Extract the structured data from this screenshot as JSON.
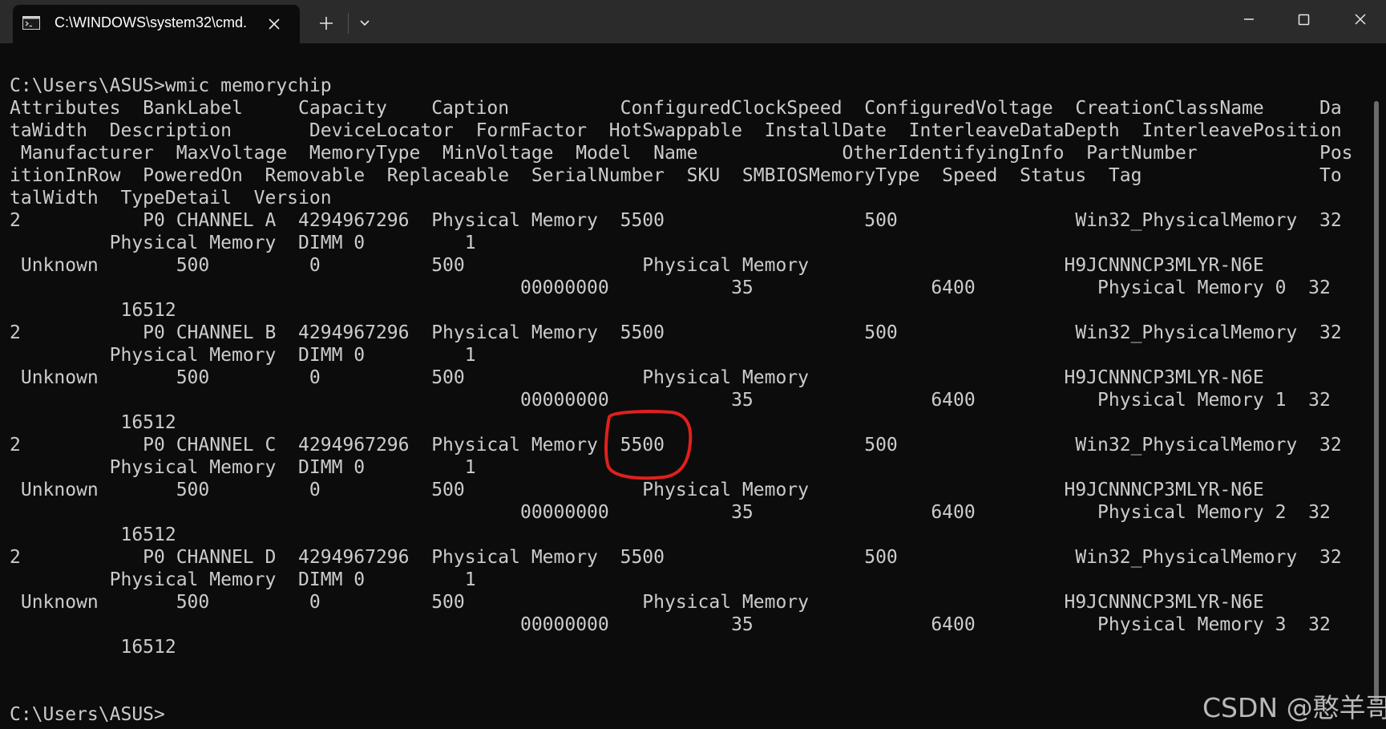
{
  "window": {
    "tab_title": "C:\\WINDOWS\\system32\\cmd.",
    "icons": {
      "tab": "console-icon",
      "close_tab": "close-icon",
      "new_tab": "plus-icon",
      "dropdown": "chevron-down-icon",
      "minimize": "minimize-icon",
      "maximize": "maximize-icon",
      "close_window": "close-icon"
    }
  },
  "console": {
    "lines": [
      "C:\\Users\\ASUS>wmic memorychip",
      "Attributes  BankLabel     Capacity    Caption          ConfiguredClockSpeed  ConfiguredVoltage  CreationClassName     Da",
      "taWidth  Description       DeviceLocator  FormFactor  HotSwappable  InstallDate  InterleaveDataDepth  InterleavePosition",
      " Manufacturer  MaxVoltage  MemoryType  MinVoltage  Model  Name             OtherIdentifyingInfo  PartNumber           Pos",
      "itionInRow  PoweredOn  Removable  Replaceable  SerialNumber  SKU  SMBIOSMemoryType  Speed  Status  Tag                To",
      "talWidth  TypeDetail  Version",
      "2           P0 CHANNEL A  4294967296  Physical Memory  5500                  500                Win32_PhysicalMemory  32",
      "         Physical Memory  DIMM 0         1",
      " Unknown       500         0          500                Physical Memory                       H9JCNNNCP3MLYR-N6E",
      "                                              00000000           35                6400           Physical Memory 0  32",
      "          16512",
      "2           P0 CHANNEL B  4294967296  Physical Memory  5500                  500                Win32_PhysicalMemory  32",
      "         Physical Memory  DIMM 0         1",
      " Unknown       500         0          500                Physical Memory                       H9JCNNNCP3MLYR-N6E",
      "                                              00000000           35                6400           Physical Memory 1  32",
      "          16512",
      "2           P0 CHANNEL C  4294967296  Physical Memory  5500                  500                Win32_PhysicalMemory  32",
      "         Physical Memory  DIMM 0         1",
      " Unknown       500         0          500                Physical Memory                       H9JCNNNCP3MLYR-N6E",
      "                                              00000000           35                6400           Physical Memory 2  32",
      "          16512",
      "2           P0 CHANNEL D  4294967296  Physical Memory  5500                  500                Win32_PhysicalMemory  32",
      "         Physical Memory  DIMM 0         1",
      " Unknown       500         0          500                Physical Memory                       H9JCNNNCP3MLYR-N6E",
      "                                              00000000           35                6400           Physical Memory 3  32",
      "          16512",
      "",
      "",
      "C:\\Users\\ASUS>"
    ]
  },
  "annotation": {
    "shape": "hand-drawn-ellipse",
    "color": "#e0201e",
    "highlighted_value": "5500"
  },
  "watermark": "CSDN @憨羊哥",
  "colors": {
    "console_bg": "#0c0c0c",
    "titlebar_bg": "#2b2b2b",
    "text": "#cccccc"
  }
}
